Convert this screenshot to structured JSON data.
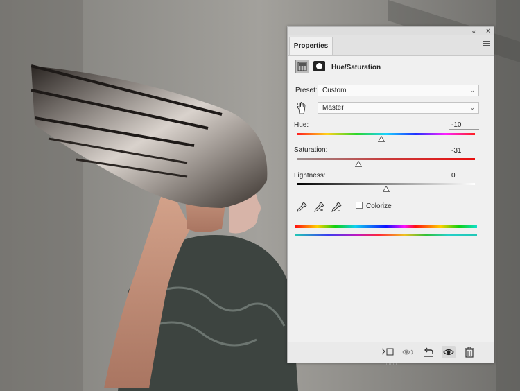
{
  "panel": {
    "tab_label": "Properties",
    "collapse_glyph": "«",
    "close_glyph": "×",
    "header_title": "Hue/Saturation"
  },
  "preset": {
    "label": "Preset:",
    "value": "Custom"
  },
  "channel": {
    "value": "Master"
  },
  "hue": {
    "label": "Hue:",
    "value": "-10",
    "level": -10
  },
  "saturation": {
    "label": "Saturation:",
    "value": "-31",
    "level": -31
  },
  "lightness": {
    "label": "Lightness:",
    "value": "0",
    "level": 0
  },
  "colorize": {
    "label": "Colorize",
    "checked": false
  },
  "icons": {
    "adjustment": "hue-saturation-adjustment-icon",
    "mask": "layer-mask-icon",
    "hand": "targeted-adjustment-hand-icon",
    "eyedroppers": [
      "eyedropper-icon",
      "add-to-sample-eyedropper-icon",
      "subtract-from-sample-eyedropper-icon"
    ],
    "footer": [
      "clip-to-layer-icon",
      "view-previous-state-icon",
      "reset-icon",
      "toggle-visibility-icon",
      "delete-icon"
    ]
  }
}
